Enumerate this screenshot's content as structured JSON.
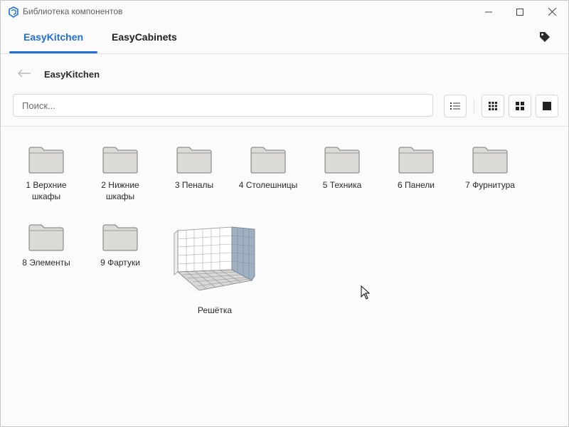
{
  "window": {
    "title": "Библиотека компонентов"
  },
  "tabs": [
    {
      "label": "EasyKitchen",
      "active": true
    },
    {
      "label": "EasyCabinets",
      "active": false
    }
  ],
  "breadcrumb": {
    "title": "EasyKitchen"
  },
  "search": {
    "placeholder": "Поиск..."
  },
  "items": [
    {
      "label": "1 Верхние шкафы",
      "icon": "folder-icon"
    },
    {
      "label": "2 Нижние шкафы",
      "icon": "folder-icon"
    },
    {
      "label": "3 Пеналы",
      "icon": "folder-icon"
    },
    {
      "label": "4 Столешницы",
      "icon": "folder-icon"
    },
    {
      "label": "5 Техника",
      "icon": "folder-icon"
    },
    {
      "label": "6 Панели",
      "icon": "folder-icon"
    },
    {
      "label": "7 Фурнитура",
      "icon": "folder-icon"
    },
    {
      "label": "8 Элементы",
      "icon": "folder-icon"
    },
    {
      "label": "9 Фартуки",
      "icon": "folder-icon"
    },
    {
      "label": "Решётка",
      "icon": "grid-component-thumbnail"
    }
  ],
  "colors": {
    "accent": "#1f6fd6",
    "folder_fill": "#dcdad7",
    "folder_stroke": "#7a7a7a"
  }
}
